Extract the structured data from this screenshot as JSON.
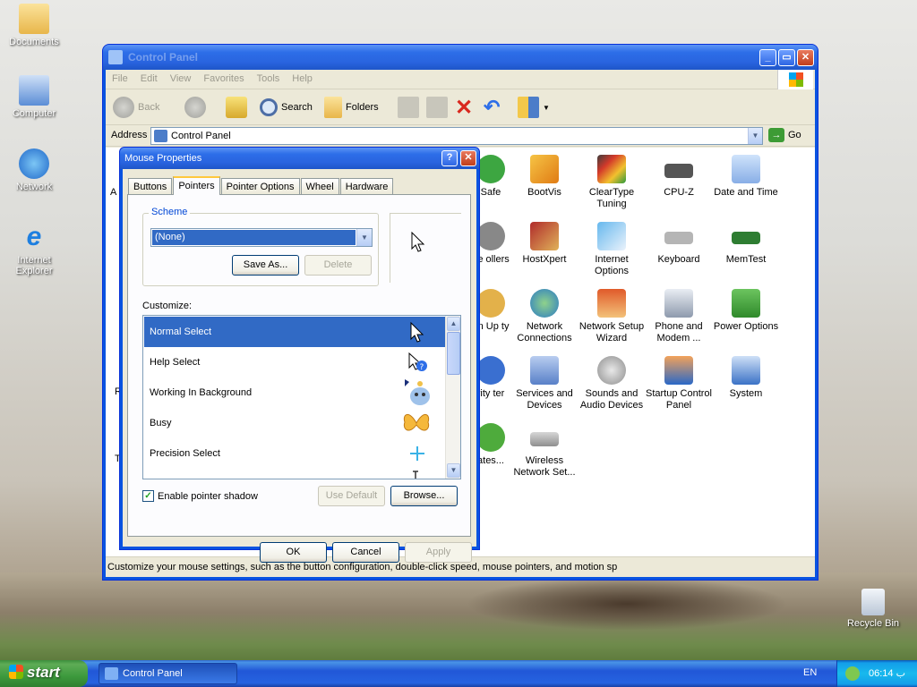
{
  "desktop": {
    "icons": [
      {
        "label": "Documents",
        "icon": "folder-icon"
      },
      {
        "label": "Computer",
        "icon": "computer-icon"
      },
      {
        "label": "Network",
        "icon": "network-icon"
      },
      {
        "label": "Internet Explorer",
        "icon": "internet-explorer-icon"
      },
      {
        "label": "Recycle Bin",
        "icon": "recycle-bin-icon"
      }
    ]
  },
  "explorer": {
    "title": "Control Panel",
    "menu": [
      "File",
      "Edit",
      "View",
      "Favorites",
      "Tools",
      "Help"
    ],
    "toolbar": {
      "back": "Back",
      "search": "Search",
      "folders": "Folders"
    },
    "address": {
      "label": "Address",
      "value": "Control Panel",
      "go": "Go"
    },
    "items": [
      {
        "label": "Safe",
        "icon": "safe-icon"
      },
      {
        "label": "BootVis",
        "icon": "bootvis-icon"
      },
      {
        "label": "ClearType Tuning",
        "icon": "cleartype-icon"
      },
      {
        "label": "CPU-Z",
        "icon": "cpu-icon"
      },
      {
        "label": "Date and Time",
        "icon": "date-time-icon"
      },
      {
        "label": "ne ollers",
        "icon": "game-controllers-icon"
      },
      {
        "label": "HostXpert",
        "icon": "hostxpert-icon"
      },
      {
        "label": "Internet Options",
        "icon": "internet-options-icon"
      },
      {
        "label": "Keyboard",
        "icon": "keyboard-icon"
      },
      {
        "label": "MemTest",
        "icon": "memtest-icon"
      },
      {
        "label": "an Up ty",
        "icon": "clean-up-icon"
      },
      {
        "label": "Network Connections",
        "icon": "network-connections-icon"
      },
      {
        "label": "Network Setup Wizard",
        "icon": "network-setup-icon"
      },
      {
        "label": "Phone and Modem ...",
        "icon": "phone-modem-icon"
      },
      {
        "label": "Power Options",
        "icon": "power-options-icon"
      },
      {
        "label": "rity ter",
        "icon": "security-center-icon"
      },
      {
        "label": "Services and Devices",
        "icon": "services-icon"
      },
      {
        "label": "Sounds and Audio Devices",
        "icon": "sounds-icon"
      },
      {
        "label": "Startup Control Panel",
        "icon": "startup-icon"
      },
      {
        "label": "System",
        "icon": "system-icon"
      },
      {
        "label": "ates...",
        "icon": "updates-icon"
      },
      {
        "label": "Wireless Network Set...",
        "icon": "wireless-icon"
      }
    ],
    "status": "Customize your mouse settings, such as the button configuration, double-click speed, mouse pointers, and motion sp"
  },
  "dialog": {
    "title": "Mouse Properties",
    "tabs": [
      "Buttons",
      "Pointers",
      "Pointer Options",
      "Wheel",
      "Hardware"
    ],
    "active_tab": "Pointers",
    "scheme_label": "Scheme",
    "scheme_value": "(None)",
    "save_as": "Save As...",
    "delete": "Delete",
    "customize_label": "Customize:",
    "pointers": [
      {
        "label": "Normal Select",
        "selected": true,
        "icon": "arrow-cursor-icon"
      },
      {
        "label": "Help Select",
        "selected": false,
        "icon": "help-cursor-icon"
      },
      {
        "label": "Working In Background",
        "selected": false,
        "icon": "working-cursor-icon"
      },
      {
        "label": "Busy",
        "selected": false,
        "icon": "busy-butterfly-icon"
      },
      {
        "label": "Precision Select",
        "selected": false,
        "icon": "crosshair-cursor-icon"
      }
    ],
    "shadow_label": "Enable pointer shadow",
    "shadow_checked": true,
    "use_default": "Use Default",
    "browse": "Browse...",
    "ok": "OK",
    "cancel": "Cancel",
    "apply": "Apply"
  },
  "taskbar": {
    "start": "start",
    "task": "Control Panel",
    "lang": "EN",
    "time": "06:14 ‎ب‎"
  }
}
